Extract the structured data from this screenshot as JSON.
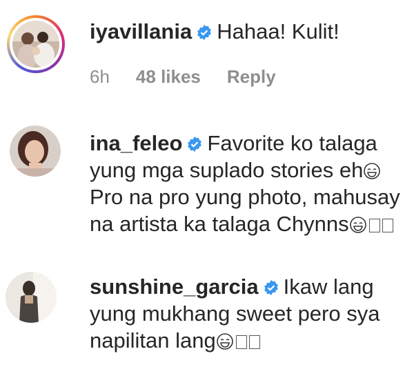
{
  "comments": [
    {
      "username": "iyavillania",
      "verified": true,
      "text": "Hahaa! Kulit!",
      "time": "6h",
      "likes": "48 likes",
      "reply": "Reply",
      "story_ring": true
    },
    {
      "username": "ina_feleo",
      "verified": true,
      "line1": "Favorite ko talaga",
      "line2": "yung mga suplado stories eh",
      "line3": "Pro na pro yung photo, mahusay",
      "line4": "na artista ka talaga Chynns"
    },
    {
      "username": "sunshine_garcia",
      "verified": true,
      "line1": "Ikaw lang",
      "line2": "yung mukhang sweet pero sya",
      "line3": "napilitan lang"
    }
  ],
  "colors": {
    "verified_badge": "#3897f0",
    "meta_text": "#8e8e8e",
    "body_text": "#262626"
  },
  "icons": {
    "verified": "verified-badge-icon",
    "laughing_emoji": "grinning-sweat-emoji",
    "unknown_glyph": "missing-glyph-box"
  }
}
